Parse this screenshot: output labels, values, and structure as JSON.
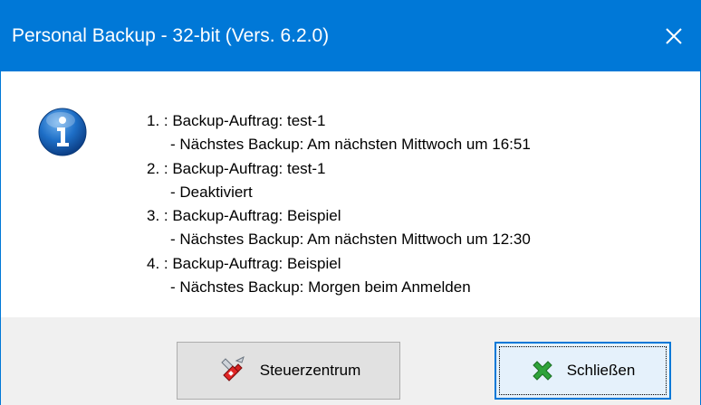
{
  "window": {
    "title": "Personal Backup - 32-bit (Vers. 6.2.0)",
    "close_glyph": "✕",
    "accent_color": "#0078d7"
  },
  "dialog": {
    "icon": "info-icon",
    "lines": [
      "1. : Backup-Auftrag: test-1",
      "- Nächstes Backup: Am nächsten Mittwoch um 16:51",
      "2. : Backup-Auftrag: test-1",
      "- Deaktiviert",
      "3. : Backup-Auftrag: Beispiel",
      "- Nächstes Backup: Am nächsten Mittwoch um 12:30",
      "4. : Backup-Auftrag: Beispiel",
      "- Nächstes Backup: Morgen beim Anmelden"
    ]
  },
  "buttons": {
    "steuerzentrum": {
      "label": "Steuerzentrum",
      "icon": "swiss-knife-icon"
    },
    "schliessen": {
      "label": "Schließen",
      "icon": "green-x-icon"
    }
  }
}
